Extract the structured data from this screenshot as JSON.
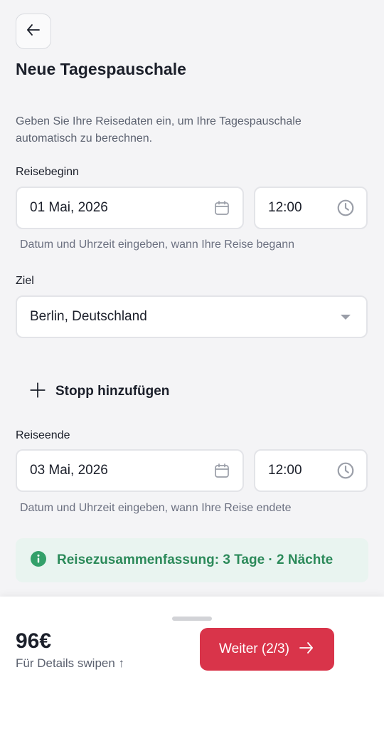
{
  "page": {
    "title": "Neue Tagespauschale",
    "intro": "Geben Sie Ihre Reisedaten ein, um Ihre Tagespauschale automatisch zu berechnen."
  },
  "trip_start": {
    "label": "Reisebeginn",
    "date": "01 Mai, 2026",
    "time": "12:00",
    "helper": "Datum und Uhrzeit eingeben, wann Ihre Reise begann"
  },
  "destination": {
    "label": "Ziel",
    "value": "Berlin, Deutschland"
  },
  "add_stop": {
    "label": "Stopp hinzufügen"
  },
  "trip_end": {
    "label": "Reiseende",
    "date": "03 Mai, 2026",
    "time": "12:00",
    "helper": "Datum und Uhrzeit eingeben, wann Ihre Reise endete"
  },
  "summary": {
    "text": "Reisezusammenfassung: 3 Tage · 2 Nächte"
  },
  "footer": {
    "price": "96€",
    "swipe_hint": "Für Details swipen ↑",
    "next_label": "Weiter (2/3)"
  },
  "icons": {
    "back": "arrow-left-icon",
    "calendar": "calendar-icon",
    "clock": "clock-icon",
    "dropdown": "caret-down-icon",
    "plus": "plus-icon",
    "info": "info-icon",
    "next": "arrow-right-icon"
  },
  "colors": {
    "primary": "#d9344a",
    "success_text": "#2c8a5a",
    "success_bg": "#e9f4f0",
    "background": "#f4f4f6"
  }
}
